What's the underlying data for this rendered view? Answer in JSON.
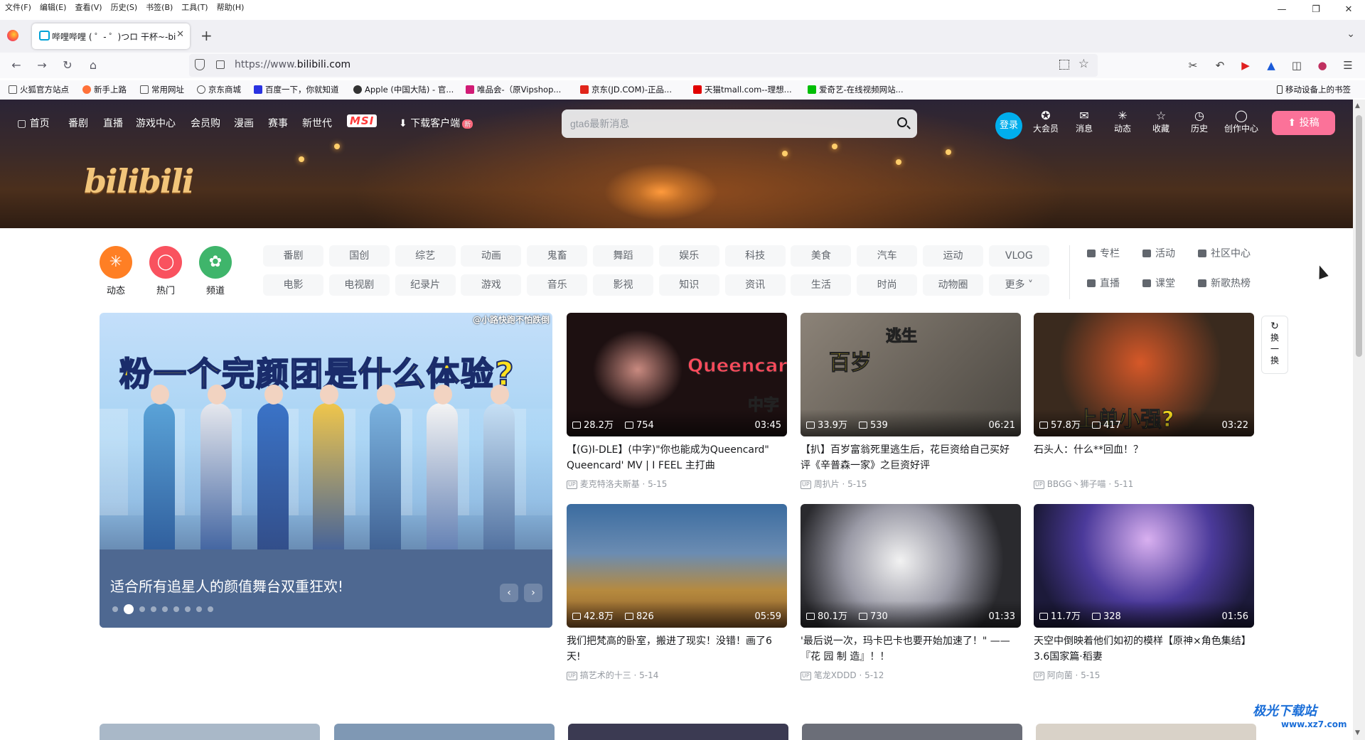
{
  "browser": {
    "menu": [
      "文件(F)",
      "编辑(E)",
      "查看(V)",
      "历史(S)",
      "书签(B)",
      "工具(T)",
      "帮助(H)"
    ],
    "tab_title": "哔哩哔哩 ( ゜- ゜)つロ 干杯~-bi",
    "url_prefix": "https://www.",
    "url_domain": "bilibili.com",
    "bookmarks": [
      "火狐官方站点",
      "新手上路",
      "常用网址",
      "京东商城",
      "百度一下，你就知道",
      "Apple (中国大陆) - 官...",
      "唯品会-（原Vipshop...",
      "京东(JD.COM)-正品...",
      "天猫tmall.com--理想...",
      "爱奇艺-在线视频网站..."
    ],
    "mobile_bookmarks": "移动设备上的书签"
  },
  "topnav": {
    "items": [
      "首页",
      "番剧",
      "直播",
      "游戏中心",
      "会员购",
      "漫画",
      "赛事",
      "新世代"
    ],
    "msi": "MSI",
    "download": "下载客户端",
    "download_badge": "新"
  },
  "search": {
    "placeholder": "gta6最新消息"
  },
  "header_right": {
    "login": "登录",
    "icons": [
      "大会员",
      "消息",
      "动态",
      "收藏",
      "历史",
      "创作中心"
    ],
    "upload": "投稿"
  },
  "logo": "bilibili",
  "channels": {
    "circles": [
      {
        "label": "动态",
        "color": "#ff7f24"
      },
      {
        "label": "热门",
        "color": "#f9525f"
      },
      {
        "label": "频道",
        "color": "#3fb56b"
      }
    ],
    "row1": [
      "番剧",
      "国创",
      "综艺",
      "动画",
      "鬼畜",
      "舞蹈",
      "娱乐",
      "科技",
      "美食",
      "汽车",
      "运动",
      "VLOG"
    ],
    "row2": [
      "电影",
      "电视剧",
      "纪录片",
      "游戏",
      "音乐",
      "影视",
      "知识",
      "资讯",
      "生活",
      "时尚",
      "动物圈",
      "更多"
    ],
    "quick1": [
      "专栏",
      "活动",
      "社区中心"
    ],
    "quick2": [
      "直播",
      "课堂",
      "新歌热榜"
    ]
  },
  "carousel": {
    "headline_a": "粉一个",
    "headline_b": "完颜团",
    "headline_c": "是什么体验?",
    "watermark": "@小路快跑不怕跌倒",
    "title": "适合所有追星人的颜值舞台双重狂欢!",
    "dot_count": 9,
    "active_dot": 1
  },
  "refresh": {
    "l1": "换",
    "l2": "一",
    "l3": "换"
  },
  "videos": [
    {
      "views": "28.2万",
      "danmaku": "754",
      "duration": "03:45",
      "title": "【(G)I-DLE】(中字)\"你也能成为Queencard\" Queencard' MV | I FEEL 主打曲",
      "uploader": "麦克特洛夫斯基",
      "date": "5-15",
      "thumb_text": "Queencard",
      "thumb_sub": "中字"
    },
    {
      "views": "33.9万",
      "danmaku": "539",
      "duration": "06:21",
      "title": "【扒】百岁富翁死里逃生后，花巨资给自己买好评《辛普森一家》之巨资好评",
      "uploader": "周扒片",
      "date": "5-15",
      "thumb_text": "百岁",
      "thumb_sub": "逃生"
    },
    {
      "views": "57.8万",
      "danmaku": "417",
      "duration": "03:22",
      "title": "石头人：什么**回血！？",
      "uploader": "BBGG丶狮子喵",
      "date": "5-11",
      "thumb_text": "上单小强?",
      "thumb_sub": ""
    },
    {
      "views": "42.8万",
      "danmaku": "826",
      "duration": "05:59",
      "title": "我们把梵高的卧室，搬进了现实！没错！画了6天!",
      "uploader": "搞艺术的十三",
      "date": "5-14",
      "thumb_text": "",
      "thumb_sub": ""
    },
    {
      "views": "80.1万",
      "danmaku": "730",
      "duration": "01:33",
      "title": "'最后说一次，玛卡巴卡也要开始加速了！\" ——『花 园 制 造』！！",
      "uploader": "笔龙XDDD",
      "date": "5-12",
      "thumb_text": "",
      "thumb_sub": ""
    },
    {
      "views": "11.7万",
      "danmaku": "328",
      "duration": "01:56",
      "title": "天空中倒映着他们如初的模样【原神×角色集结】3.6国家篇·稻妻",
      "uploader": "阿向菌",
      "date": "5-15",
      "thumb_text": "",
      "thumb_sub": ""
    }
  ],
  "watermark": {
    "text": "极光下载站",
    "url": "www.xz7.com"
  }
}
